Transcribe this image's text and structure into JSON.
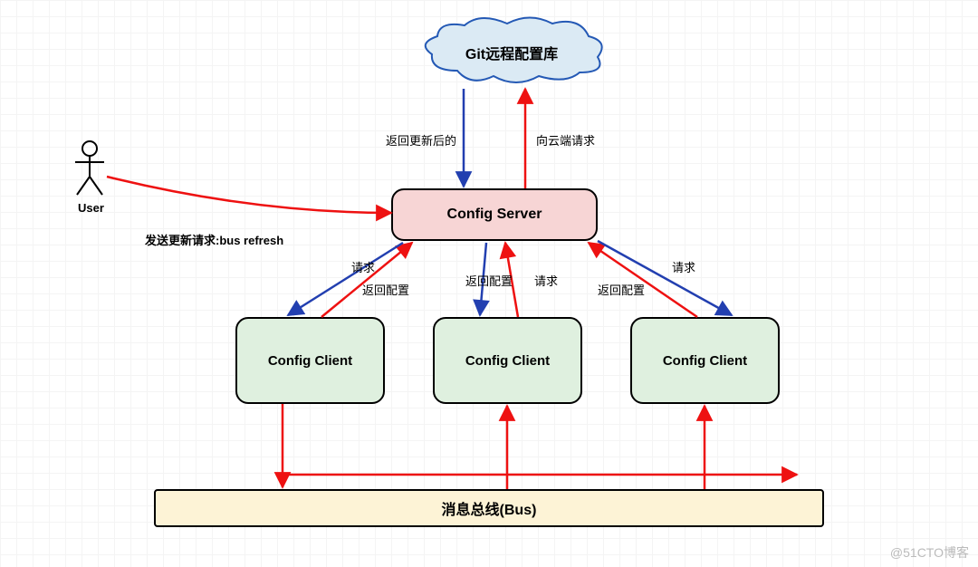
{
  "cloud": {
    "label": "Git远程配置库"
  },
  "server": {
    "label": "Config Server"
  },
  "clients": [
    {
      "label": "Config Client"
    },
    {
      "label": "Config Client"
    },
    {
      "label": "Config Client"
    }
  ],
  "bus": {
    "label": "消息总线(Bus)"
  },
  "actor": {
    "label": "User"
  },
  "edges": {
    "to_cloud": "向云端请求",
    "from_cloud": "返回更新后的",
    "request": "请求",
    "return_cfg": "返回配置",
    "user_action": "发送更新请求:bus refresh"
  },
  "watermark": "@51CTO博客"
}
